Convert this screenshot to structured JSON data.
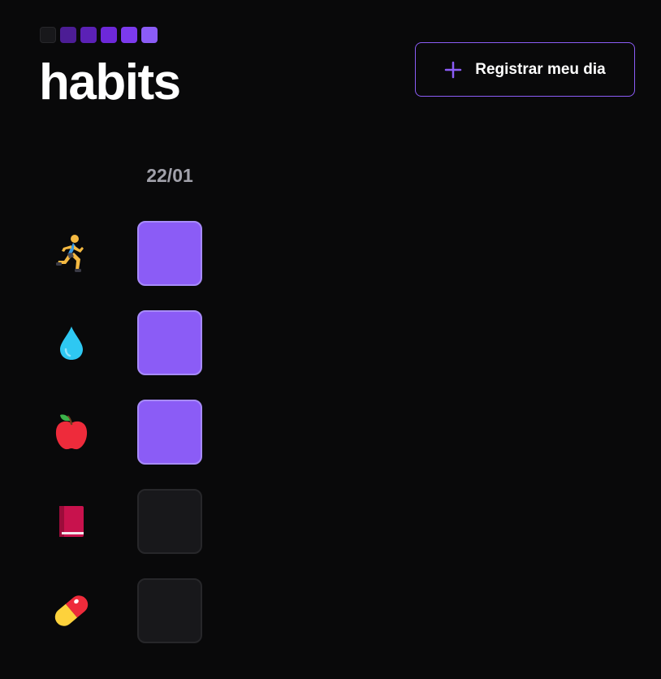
{
  "app": {
    "logo_text": "habits",
    "logo_square_colors": [
      "#18181b",
      "#4c1d95",
      "#5b21b6",
      "#6d28d9",
      "#7c3aed",
      "#8b5cf6"
    ]
  },
  "header": {
    "register_label": "Registrar meu dia",
    "accent_color": "#8b5cf6"
  },
  "table": {
    "date": "22/01",
    "habits": [
      {
        "icon": "runner-icon",
        "completed": true
      },
      {
        "icon": "water-drop-icon",
        "completed": true
      },
      {
        "icon": "apple-icon",
        "completed": true
      },
      {
        "icon": "book-icon",
        "completed": false
      },
      {
        "icon": "pill-icon",
        "completed": false
      }
    ]
  },
  "colors": {
    "background": "#09090a",
    "completed_cell": "#8b5cf6",
    "empty_cell": "#18181b"
  }
}
